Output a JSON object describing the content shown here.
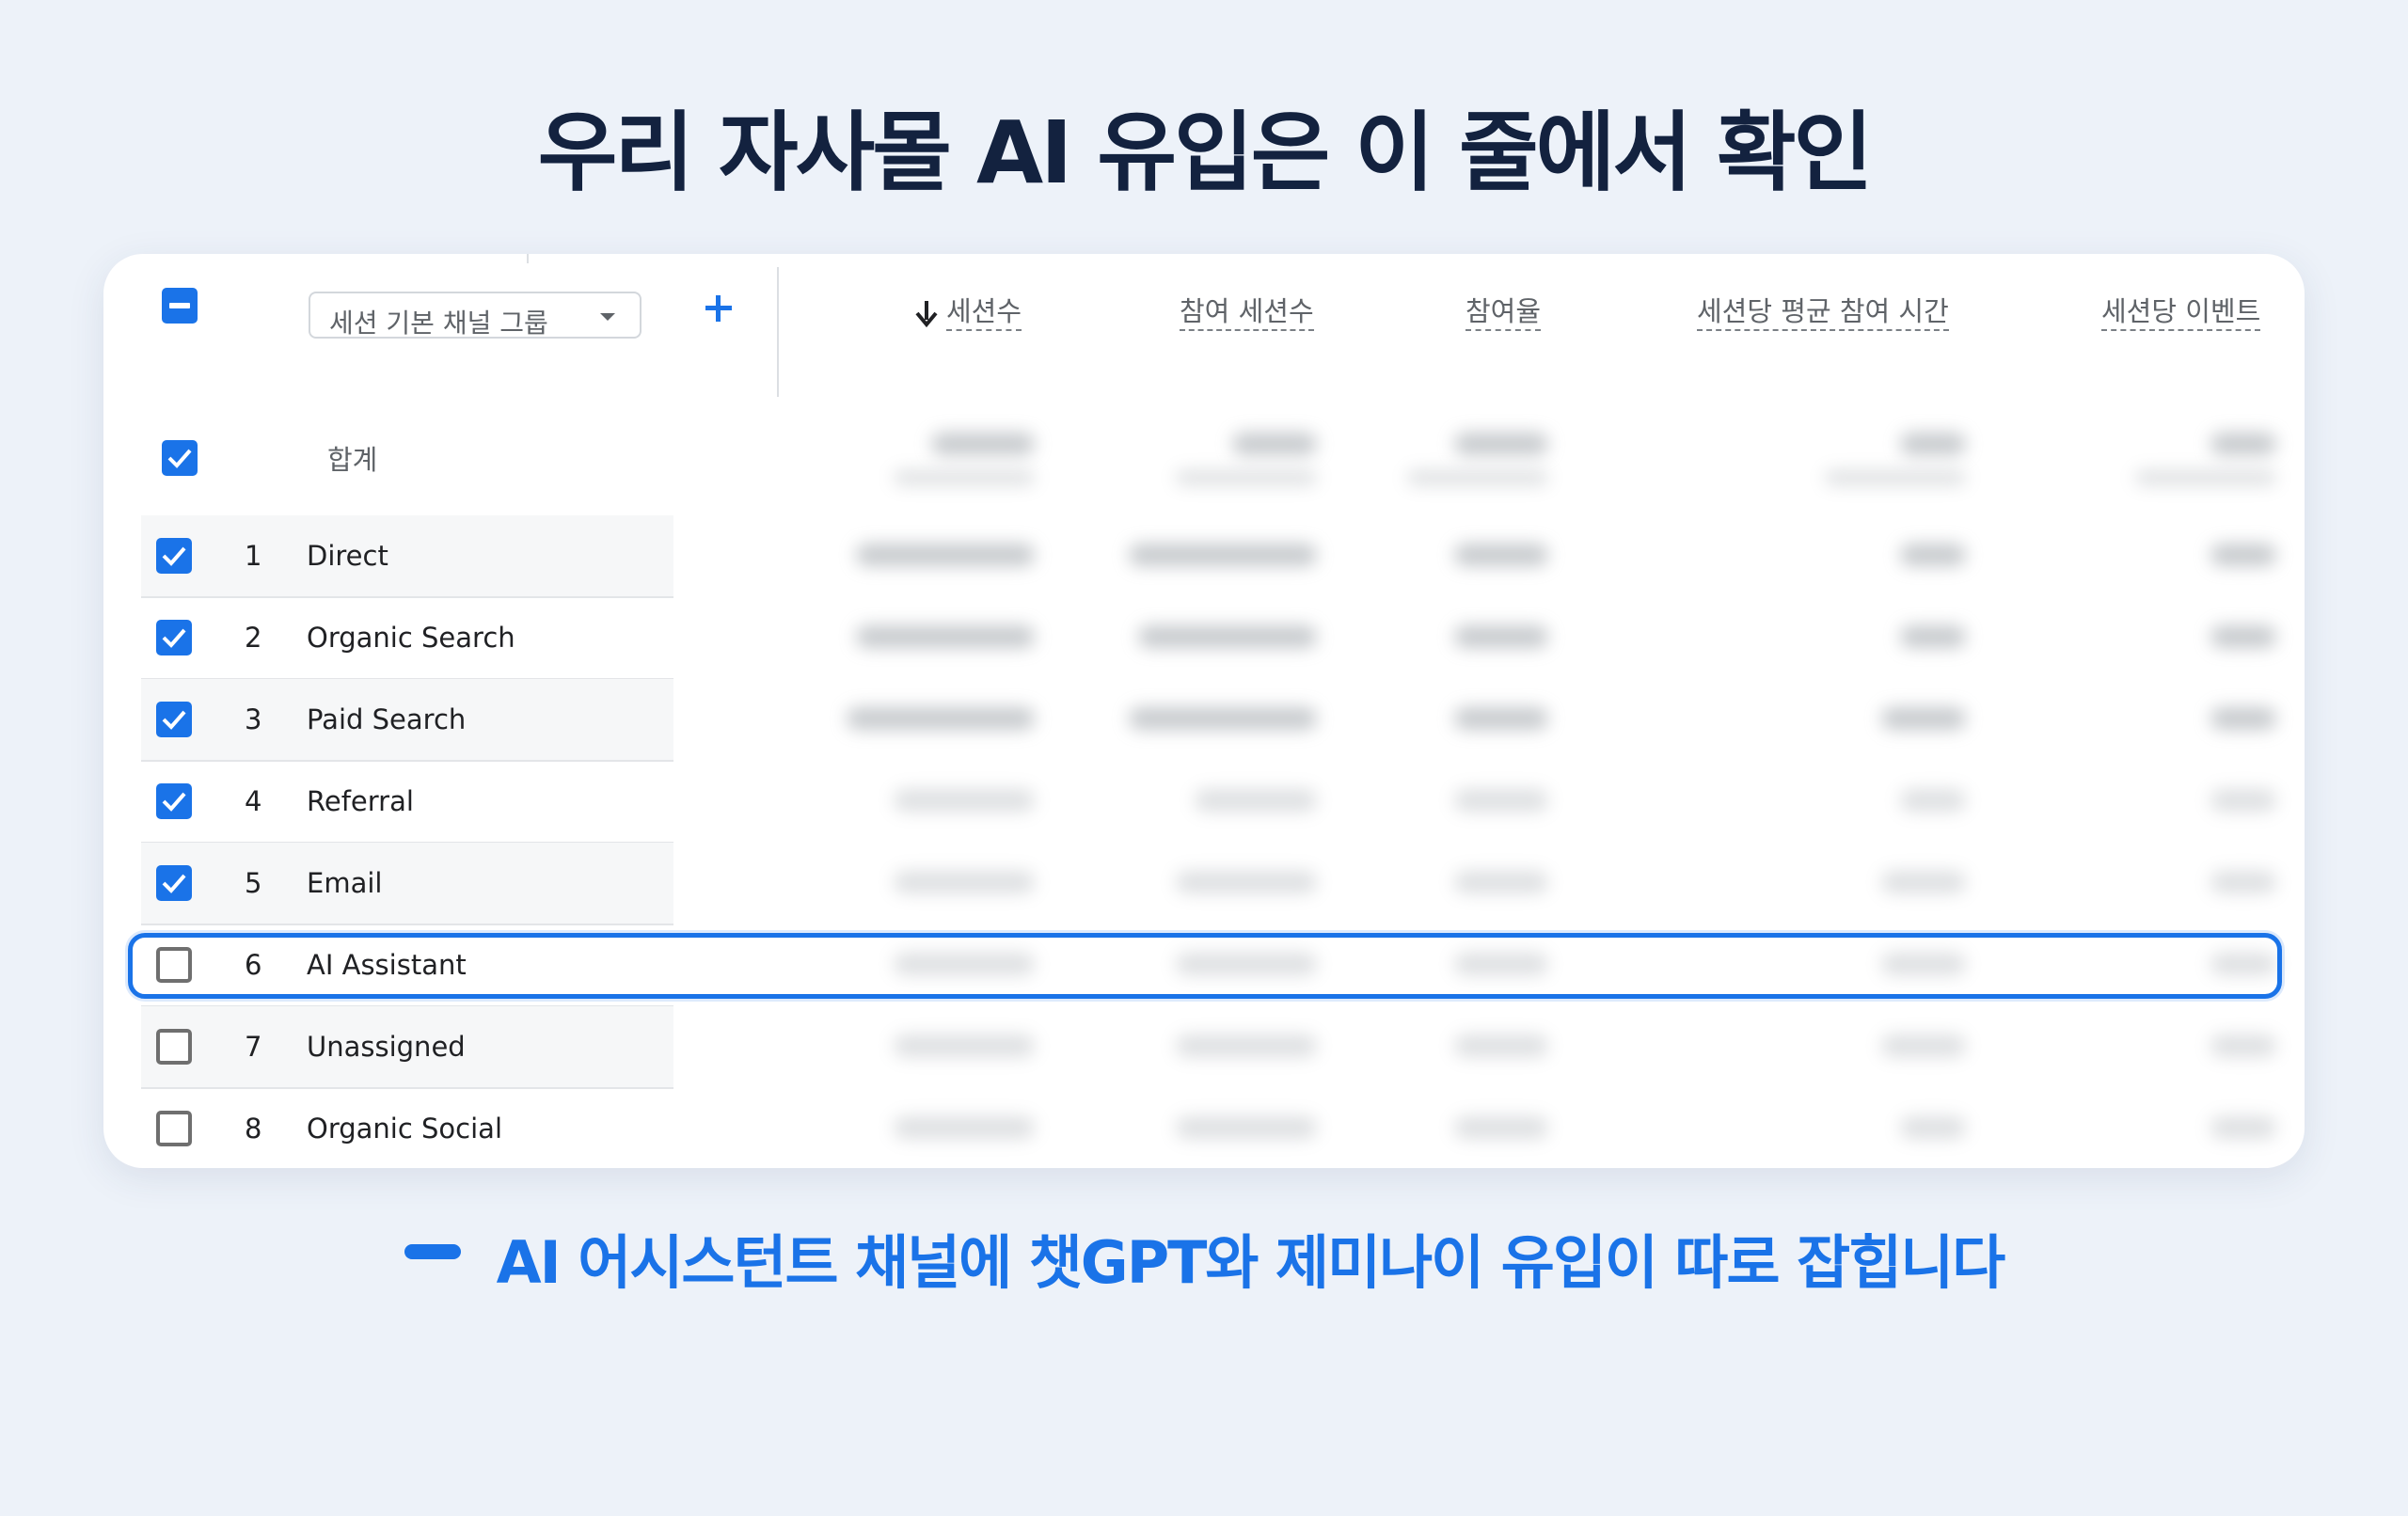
{
  "title": "우리 자사몰 AI 유입은 이 줄에서 확인",
  "table": {
    "dimension_select": "세션 기본 채널 그룹",
    "columns": [
      "세션수",
      "참여 세션수",
      "참여율",
      "세션당 평균 참여 시간",
      "세션당 이벤트"
    ],
    "sort_column": "세션수",
    "total_label": "합계",
    "rows": [
      {
        "num": "1",
        "name": "Direct",
        "checked": true
      },
      {
        "num": "2",
        "name": "Organic Search",
        "checked": true
      },
      {
        "num": "3",
        "name": "Paid Search",
        "checked": true
      },
      {
        "num": "4",
        "name": "Referral",
        "checked": true
      },
      {
        "num": "5",
        "name": "Email",
        "checked": true
      },
      {
        "num": "6",
        "name": "AI Assistant",
        "checked": false
      },
      {
        "num": "7",
        "name": "Unassigned",
        "checked": false
      },
      {
        "num": "8",
        "name": "Organic Social",
        "checked": false
      }
    ],
    "highlighted_row": "AI Assistant"
  },
  "caption": "AI 어시스턴트 채널에 챗GPT와 제미나이 유입이 따로 잡힙니다",
  "colors": {
    "accent": "#1a73e8",
    "title": "#13223f",
    "background": "#edf2f9"
  }
}
